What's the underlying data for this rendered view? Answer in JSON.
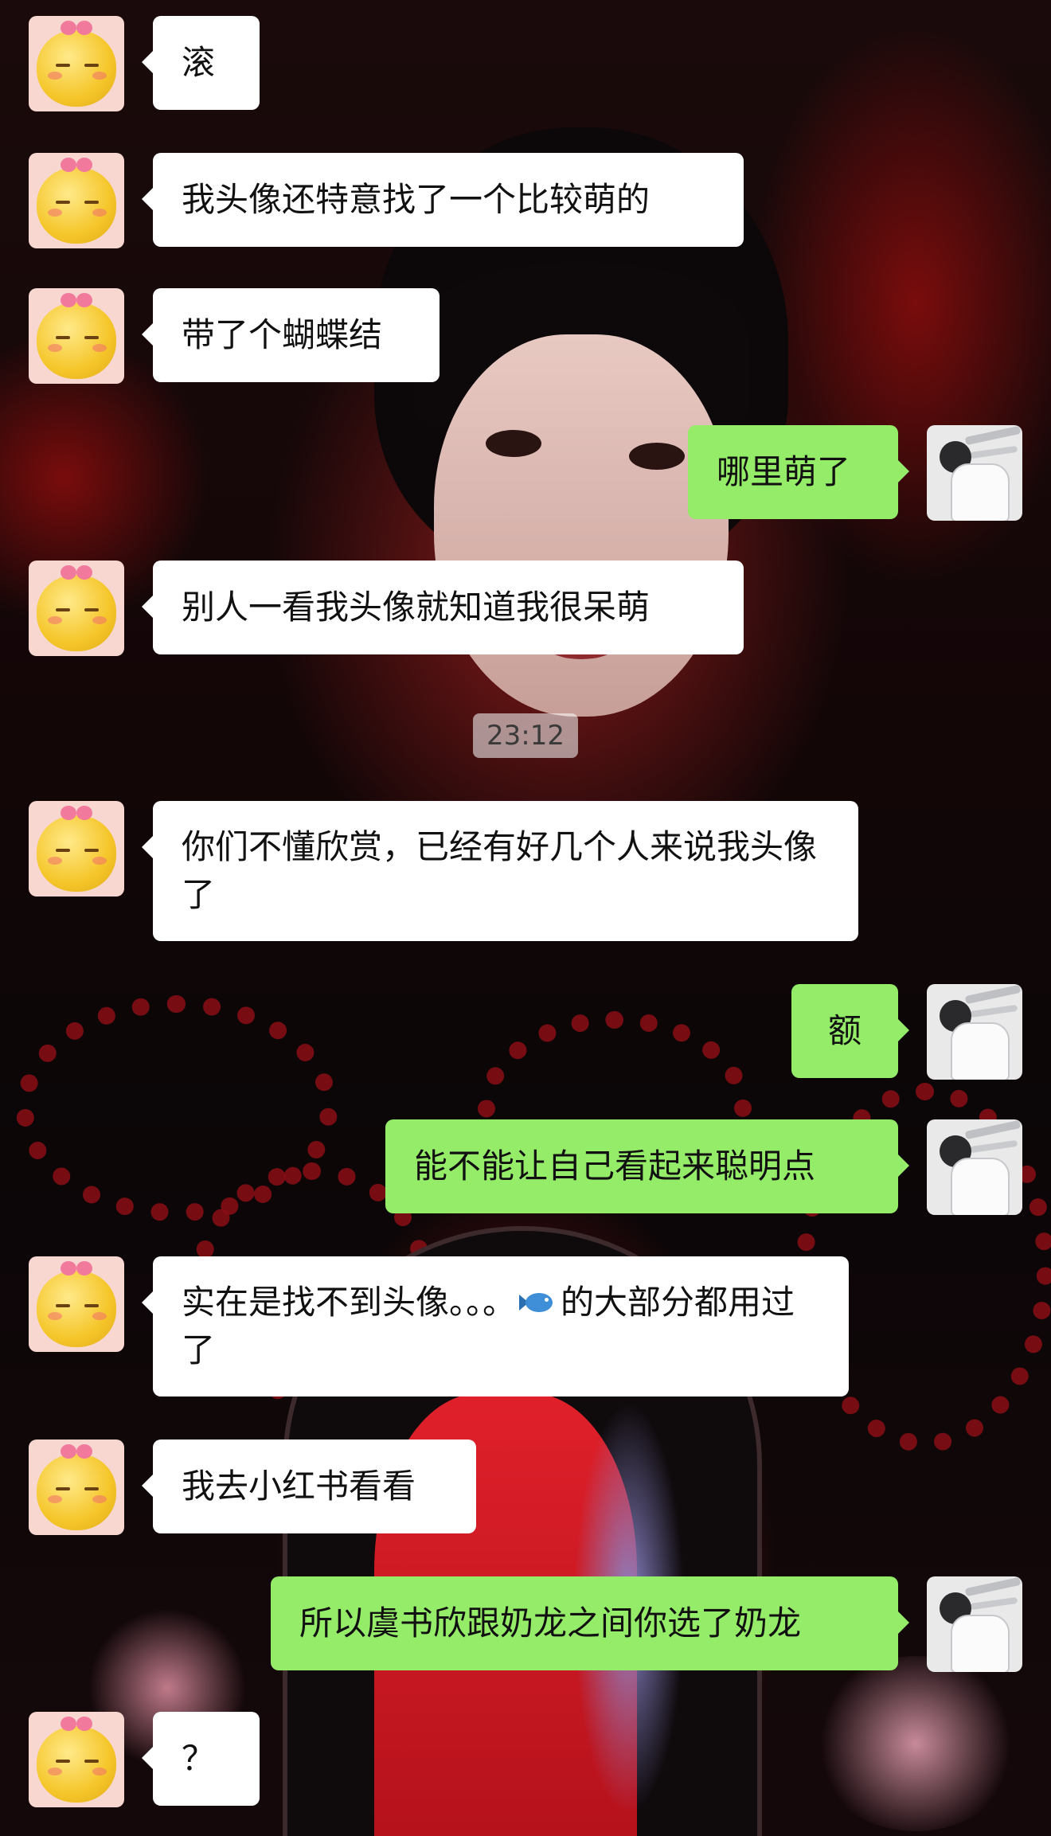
{
  "timestamp": "23:12",
  "avatars": {
    "friend": "yellow-duck-with-pink-bow",
    "me": "girl-in-white-outfit"
  },
  "colors": {
    "incoming_bubble": "#ffffff",
    "outgoing_bubble": "#95ec69"
  },
  "messages": [
    {
      "side": "in",
      "text": "滚"
    },
    {
      "side": "in",
      "text": "我头像还特意找了一个比较萌的"
    },
    {
      "side": "in",
      "text": "带了个蝴蝶结"
    },
    {
      "side": "out",
      "text": "哪里萌了"
    },
    {
      "side": "in",
      "text": "别人一看我头像就知道我很呆萌"
    },
    {
      "side": "in",
      "text": "你们不懂欣赏，已经有好几个人来说我头像了"
    },
    {
      "side": "out",
      "text": "额"
    },
    {
      "side": "out",
      "text": "能不能让自己看起来聪明点"
    },
    {
      "side": "in",
      "text_before": "实在是找不到头像。。。",
      "emoji": "fish-emoji",
      "text_after": "的大部分都用过了"
    },
    {
      "side": "in",
      "text": "我去小红书看看"
    },
    {
      "side": "out",
      "text": "所以虞书欣跟奶龙之间你选了奶龙"
    },
    {
      "side": "in",
      "text": "？"
    }
  ]
}
